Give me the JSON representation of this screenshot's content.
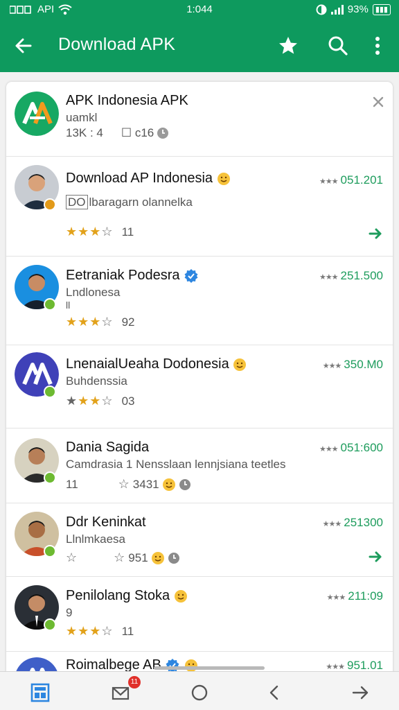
{
  "status_bar": {
    "left_text": "API",
    "time": "1:044",
    "battery": "93%"
  },
  "app_bar": {
    "title": "Download APK",
    "icons": [
      "back-arrow-icon",
      "star-icon",
      "search-icon",
      "more-vert-icon"
    ]
  },
  "header_app": {
    "name": "APK Indonesia APK",
    "subtitle": "uamkl",
    "meta_left": "13K : 4",
    "meta_right": "☐ c16"
  },
  "rows": [
    {
      "name": "Download AP Indonesia",
      "subtitle": "lbaragarn olannelka",
      "subtitle_prefix": "DO",
      "rating_text": "11",
      "price": "051.201",
      "stars_filled": 3
    },
    {
      "name": "Eetraniak Podesra",
      "subtitle": "Lndlonesa",
      "extra": "ll",
      "rating_text": "92",
      "price": "251.500",
      "stars_filled": 3
    },
    {
      "name": "LnenaialUeaha Dodonesia",
      "subtitle": "Buhdenssia",
      "rating_text": "03",
      "price": "350.M0",
      "stars_filled": 2
    },
    {
      "name": "Dania Sagida",
      "subtitle": "Camdrasia 1 Nensslaan lennjsiana teetles",
      "rating_left": "11",
      "rating_text": "3431",
      "price": "051:600"
    },
    {
      "name": "Ddr Keninkat",
      "subtitle": "Llnlmkaesa",
      "rating_text": "951",
      "price": "251300"
    },
    {
      "name": "Penilolang Stoka",
      "subtitle": "9",
      "rating_text": "11",
      "price": "211:09",
      "stars_filled": 3
    },
    {
      "name": "Roimalbege AB",
      "price": "951.01"
    }
  ],
  "price_prefix": "★★★",
  "nav_badge": "11",
  "colors": {
    "primary": "#0e9a5e",
    "accent_price": "#1d9c5c",
    "star": "#e2a21b",
    "badge_green": "#6dba31",
    "badge_orange": "#e29a1a",
    "verified_blue": "#2d86e0",
    "notify_red": "#e0302a"
  }
}
